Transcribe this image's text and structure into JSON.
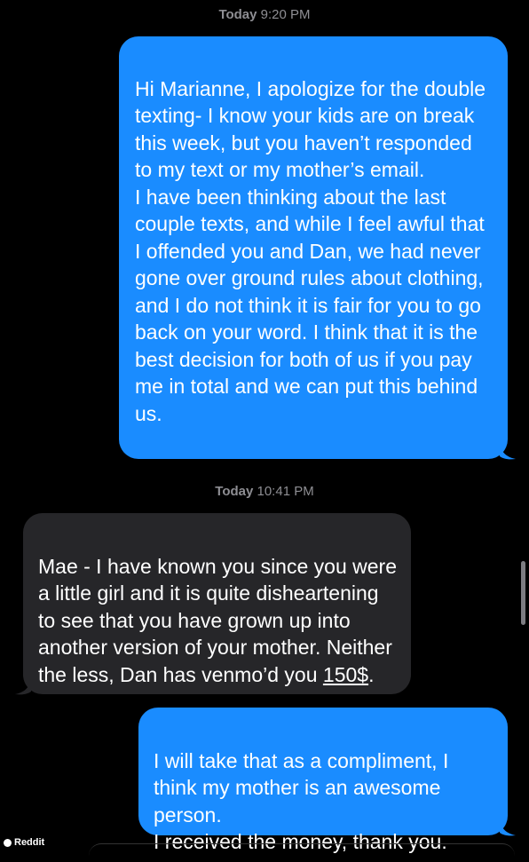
{
  "conversation": {
    "timestamp_1": {
      "day": "Today",
      "time": "9:20 PM"
    },
    "message_1": {
      "sender": "me",
      "text": "Hi Marianne, I apologize for the double texting- I know your kids are on break this week, but you haven’t responded to my text or my mother’s email.\nI have been thinking about the last couple texts, and while I feel awful that I offended you and Dan, we had never gone over ground rules about clothing, and I do not think it is fair for you to go back on your word. I think that it is the best decision for both of us if you pay me in total and we can put this behind us."
    },
    "timestamp_2": {
      "day": "Today",
      "time": "10:41 PM"
    },
    "message_2": {
      "sender": "other",
      "text_before": "Mae - I have known you since you were a little girl and it is quite disheartening to see that you have grown up into another version of your mother. Neither the less, Dan has venmo’d you ",
      "amount": "150$",
      "text_after": "."
    },
    "message_3": {
      "sender": "me",
      "text": "I will take that as a compliment, I think my mother is an awesome person.\nI received the money, thank you."
    }
  },
  "watermark": {
    "label": "Reddit"
  },
  "colors": {
    "sent_bubble": "#1a8cff",
    "received_bubble": "#262629",
    "timestamp": "#8e8e93",
    "background": "#000000"
  }
}
